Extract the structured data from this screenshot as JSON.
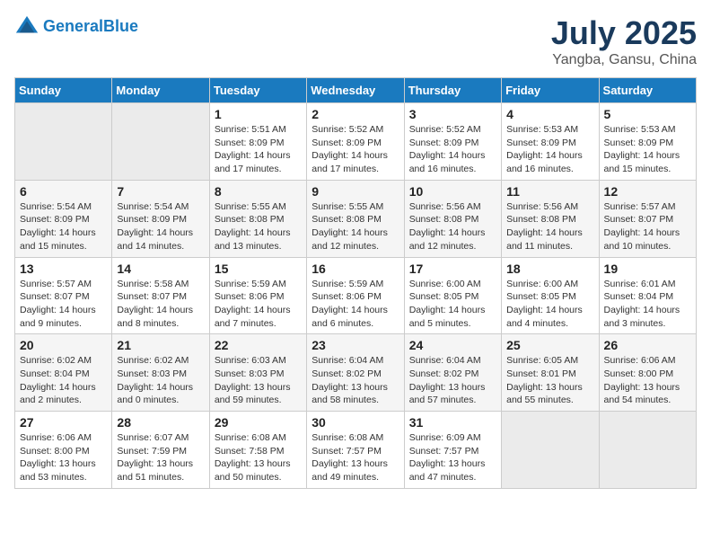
{
  "header": {
    "logo_line1": "General",
    "logo_line2": "Blue",
    "title": "July 2025",
    "subtitle": "Yangba, Gansu, China"
  },
  "days_of_week": [
    "Sunday",
    "Monday",
    "Tuesday",
    "Wednesday",
    "Thursday",
    "Friday",
    "Saturday"
  ],
  "weeks": [
    [
      {
        "day": "",
        "sunrise": "",
        "sunset": "",
        "daylight": ""
      },
      {
        "day": "",
        "sunrise": "",
        "sunset": "",
        "daylight": ""
      },
      {
        "day": "1",
        "sunrise": "Sunrise: 5:51 AM",
        "sunset": "Sunset: 8:09 PM",
        "daylight": "Daylight: 14 hours and 17 minutes."
      },
      {
        "day": "2",
        "sunrise": "Sunrise: 5:52 AM",
        "sunset": "Sunset: 8:09 PM",
        "daylight": "Daylight: 14 hours and 17 minutes."
      },
      {
        "day": "3",
        "sunrise": "Sunrise: 5:52 AM",
        "sunset": "Sunset: 8:09 PM",
        "daylight": "Daylight: 14 hours and 16 minutes."
      },
      {
        "day": "4",
        "sunrise": "Sunrise: 5:53 AM",
        "sunset": "Sunset: 8:09 PM",
        "daylight": "Daylight: 14 hours and 16 minutes."
      },
      {
        "day": "5",
        "sunrise": "Sunrise: 5:53 AM",
        "sunset": "Sunset: 8:09 PM",
        "daylight": "Daylight: 14 hours and 15 minutes."
      }
    ],
    [
      {
        "day": "6",
        "sunrise": "Sunrise: 5:54 AM",
        "sunset": "Sunset: 8:09 PM",
        "daylight": "Daylight: 14 hours and 15 minutes."
      },
      {
        "day": "7",
        "sunrise": "Sunrise: 5:54 AM",
        "sunset": "Sunset: 8:09 PM",
        "daylight": "Daylight: 14 hours and 14 minutes."
      },
      {
        "day": "8",
        "sunrise": "Sunrise: 5:55 AM",
        "sunset": "Sunset: 8:08 PM",
        "daylight": "Daylight: 14 hours and 13 minutes."
      },
      {
        "day": "9",
        "sunrise": "Sunrise: 5:55 AM",
        "sunset": "Sunset: 8:08 PM",
        "daylight": "Daylight: 14 hours and 12 minutes."
      },
      {
        "day": "10",
        "sunrise": "Sunrise: 5:56 AM",
        "sunset": "Sunset: 8:08 PM",
        "daylight": "Daylight: 14 hours and 12 minutes."
      },
      {
        "day": "11",
        "sunrise": "Sunrise: 5:56 AM",
        "sunset": "Sunset: 8:08 PM",
        "daylight": "Daylight: 14 hours and 11 minutes."
      },
      {
        "day": "12",
        "sunrise": "Sunrise: 5:57 AM",
        "sunset": "Sunset: 8:07 PM",
        "daylight": "Daylight: 14 hours and 10 minutes."
      }
    ],
    [
      {
        "day": "13",
        "sunrise": "Sunrise: 5:57 AM",
        "sunset": "Sunset: 8:07 PM",
        "daylight": "Daylight: 14 hours and 9 minutes."
      },
      {
        "day": "14",
        "sunrise": "Sunrise: 5:58 AM",
        "sunset": "Sunset: 8:07 PM",
        "daylight": "Daylight: 14 hours and 8 minutes."
      },
      {
        "day": "15",
        "sunrise": "Sunrise: 5:59 AM",
        "sunset": "Sunset: 8:06 PM",
        "daylight": "Daylight: 14 hours and 7 minutes."
      },
      {
        "day": "16",
        "sunrise": "Sunrise: 5:59 AM",
        "sunset": "Sunset: 8:06 PM",
        "daylight": "Daylight: 14 hours and 6 minutes."
      },
      {
        "day": "17",
        "sunrise": "Sunrise: 6:00 AM",
        "sunset": "Sunset: 8:05 PM",
        "daylight": "Daylight: 14 hours and 5 minutes."
      },
      {
        "day": "18",
        "sunrise": "Sunrise: 6:00 AM",
        "sunset": "Sunset: 8:05 PM",
        "daylight": "Daylight: 14 hours and 4 minutes."
      },
      {
        "day": "19",
        "sunrise": "Sunrise: 6:01 AM",
        "sunset": "Sunset: 8:04 PM",
        "daylight": "Daylight: 14 hours and 3 minutes."
      }
    ],
    [
      {
        "day": "20",
        "sunrise": "Sunrise: 6:02 AM",
        "sunset": "Sunset: 8:04 PM",
        "daylight": "Daylight: 14 hours and 2 minutes."
      },
      {
        "day": "21",
        "sunrise": "Sunrise: 6:02 AM",
        "sunset": "Sunset: 8:03 PM",
        "daylight": "Daylight: 14 hours and 0 minutes."
      },
      {
        "day": "22",
        "sunrise": "Sunrise: 6:03 AM",
        "sunset": "Sunset: 8:03 PM",
        "daylight": "Daylight: 13 hours and 59 minutes."
      },
      {
        "day": "23",
        "sunrise": "Sunrise: 6:04 AM",
        "sunset": "Sunset: 8:02 PM",
        "daylight": "Daylight: 13 hours and 58 minutes."
      },
      {
        "day": "24",
        "sunrise": "Sunrise: 6:04 AM",
        "sunset": "Sunset: 8:02 PM",
        "daylight": "Daylight: 13 hours and 57 minutes."
      },
      {
        "day": "25",
        "sunrise": "Sunrise: 6:05 AM",
        "sunset": "Sunset: 8:01 PM",
        "daylight": "Daylight: 13 hours and 55 minutes."
      },
      {
        "day": "26",
        "sunrise": "Sunrise: 6:06 AM",
        "sunset": "Sunset: 8:00 PM",
        "daylight": "Daylight: 13 hours and 54 minutes."
      }
    ],
    [
      {
        "day": "27",
        "sunrise": "Sunrise: 6:06 AM",
        "sunset": "Sunset: 8:00 PM",
        "daylight": "Daylight: 13 hours and 53 minutes."
      },
      {
        "day": "28",
        "sunrise": "Sunrise: 6:07 AM",
        "sunset": "Sunset: 7:59 PM",
        "daylight": "Daylight: 13 hours and 51 minutes."
      },
      {
        "day": "29",
        "sunrise": "Sunrise: 6:08 AM",
        "sunset": "Sunset: 7:58 PM",
        "daylight": "Daylight: 13 hours and 50 minutes."
      },
      {
        "day": "30",
        "sunrise": "Sunrise: 6:08 AM",
        "sunset": "Sunset: 7:57 PM",
        "daylight": "Daylight: 13 hours and 49 minutes."
      },
      {
        "day": "31",
        "sunrise": "Sunrise: 6:09 AM",
        "sunset": "Sunset: 7:57 PM",
        "daylight": "Daylight: 13 hours and 47 minutes."
      },
      {
        "day": "",
        "sunrise": "",
        "sunset": "",
        "daylight": ""
      },
      {
        "day": "",
        "sunrise": "",
        "sunset": "",
        "daylight": ""
      }
    ]
  ]
}
